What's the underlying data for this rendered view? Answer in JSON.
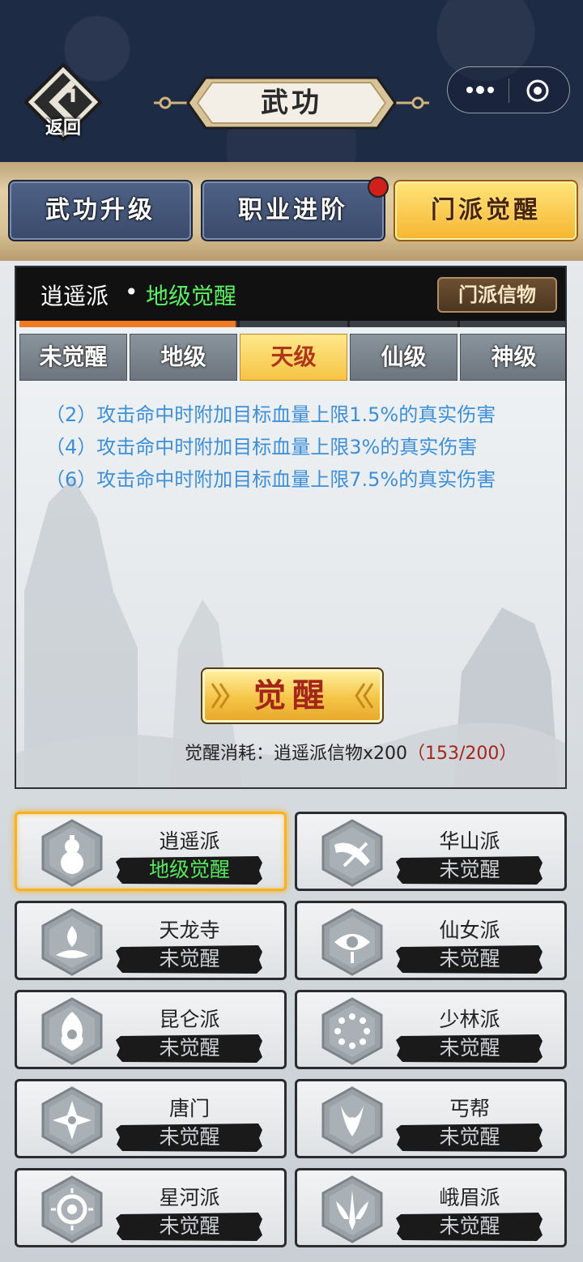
{
  "header": {
    "back_label": "返回",
    "title": "武功",
    "capsule": {
      "more_icon": "more-dots-icon",
      "target_icon": "target-icon"
    }
  },
  "tabs": [
    {
      "label": "武功升级",
      "active": false
    },
    {
      "label": "职业进阶",
      "active": false,
      "badge": true
    },
    {
      "label": "门派觉醒",
      "active": true
    }
  ],
  "panel": {
    "sect_name": "逍遥派",
    "separator": "•",
    "sect_level": "地级觉醒",
    "token_button": "门派信物",
    "progress_segments": 5,
    "progress_filled_segments": 2,
    "level_tabs": [
      {
        "label": "未觉醒",
        "active": false
      },
      {
        "label": "地级",
        "active": false
      },
      {
        "label": "天级",
        "active": true
      },
      {
        "label": "仙级",
        "active": false
      },
      {
        "label": "神级",
        "active": false
      }
    ],
    "effects": [
      "（2）攻击命中时附加目标血量上限1.5%的真实伤害",
      "（4）攻击命中时附加目标血量上限3%的真实伤害",
      "（6）攻击命中时附加目标血量上限7.5%的真实伤害"
    ],
    "awaken_button": "觉醒",
    "cost_label": "觉醒消耗：逍遥派信物x200",
    "cost_count": "（153/200）"
  },
  "sects": [
    {
      "name": "逍遥派",
      "status": "地级觉醒",
      "selected": true,
      "icon": "gourd-icon"
    },
    {
      "name": "华山派",
      "status": "未觉醒",
      "selected": false,
      "icon": "sword-wing-icon"
    },
    {
      "name": "天龙寺",
      "status": "未觉醒",
      "selected": false,
      "icon": "lotus-flame-icon"
    },
    {
      "name": "仙女派",
      "status": "未觉醒",
      "selected": false,
      "icon": "eye-icon"
    },
    {
      "name": "昆仑派",
      "status": "未觉醒",
      "selected": false,
      "icon": "flame-mask-icon"
    },
    {
      "name": "少林派",
      "status": "未觉醒",
      "selected": false,
      "icon": "prayer-beads-icon"
    },
    {
      "name": "唐门",
      "status": "未觉醒",
      "selected": false,
      "icon": "shuriken-icon"
    },
    {
      "name": "丐帮",
      "status": "未觉醒",
      "selected": false,
      "icon": "dragon-claw-icon"
    },
    {
      "name": "星河派",
      "status": "未觉醒",
      "selected": false,
      "icon": "swirl-sun-icon"
    },
    {
      "name": "峨眉派",
      "status": "未觉醒",
      "selected": false,
      "icon": "winged-sword-icon"
    }
  ]
}
